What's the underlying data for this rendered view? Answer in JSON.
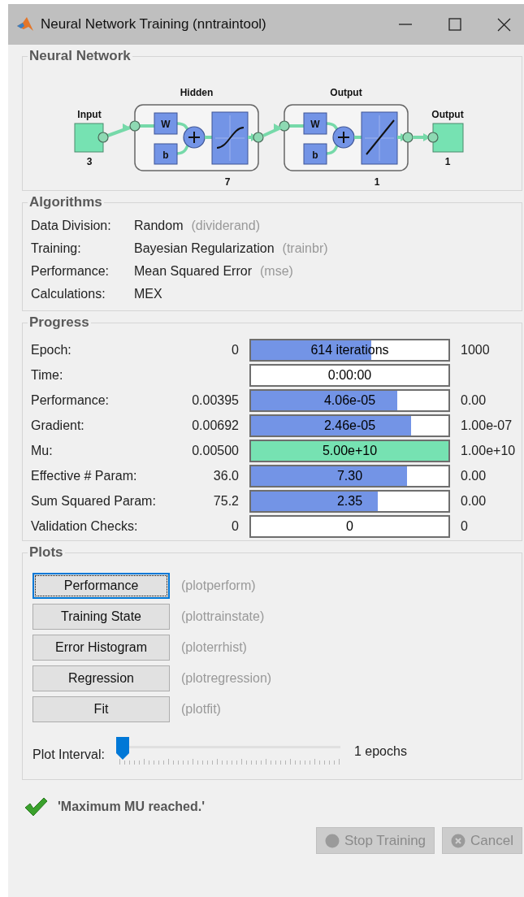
{
  "window": {
    "title": "Neural Network Training (nntraintool)"
  },
  "network": {
    "title": "Neural Network",
    "input": {
      "label": "Input",
      "size": "3"
    },
    "layers": [
      {
        "name": "Hidden",
        "size": "7",
        "kind": "sigmoid",
        "weight_label": "W",
        "bias_label": "b"
      },
      {
        "name": "Output",
        "size": "1",
        "kind": "linear",
        "weight_label": "W",
        "bias_label": "b"
      }
    ],
    "output": {
      "label": "Output",
      "size": "1"
    }
  },
  "algorithms": {
    "title": "Algorithms",
    "rows": [
      {
        "label": "Data Division:",
        "value": "Random",
        "function": "(dividerand)"
      },
      {
        "label": "Training:",
        "value": "Bayesian Regularization",
        "function": "(trainbr)"
      },
      {
        "label": "Performance:",
        "value": "Mean Squared Error",
        "function": "(mse)"
      },
      {
        "label": "Calculations:",
        "value": "MEX"
      }
    ]
  },
  "progress": {
    "title": "Progress",
    "rows": [
      {
        "label": "Epoch:",
        "start": "0",
        "reading": "614 iterations",
        "level": 0.61,
        "color": "#7394e6",
        "end": "1000"
      },
      {
        "label": "Time:",
        "reading": "0:00:00"
      },
      {
        "label": "Performance:",
        "start": "0.00395",
        "reading": "4.06e-05",
        "level": 0.74,
        "color": "#7394e6",
        "end": "0.00"
      },
      {
        "label": "Gradient:",
        "start": "0.00692",
        "reading": "2.46e-05",
        "level": 0.81,
        "color": "#7394e6",
        "end": "1.00e-07"
      },
      {
        "label": "Mu:",
        "start": "0.00500",
        "reading": "5.00e+10",
        "level": 1,
        "color": "#76e2b2",
        "end": "1.00e+10"
      },
      {
        "label": "Effective # Param:",
        "start": "36.0",
        "reading": "7.30",
        "level": 0.79,
        "color": "#7394e6",
        "end": "0.00"
      },
      {
        "label": "Sum Squared Param:",
        "start": "75.2",
        "reading": "2.35",
        "level": 0.64,
        "color": "#7394e6",
        "end": "0.00"
      },
      {
        "label": "Validation Checks:",
        "start": "0",
        "reading": "0",
        "end": "0"
      }
    ]
  },
  "plots": {
    "title": "Plots",
    "buttons": [
      {
        "label": "Performance",
        "function": "(plotperform)",
        "selected": true
      },
      {
        "label": "Training State",
        "function": "(plottrainstate)",
        "selected": false
      },
      {
        "label": "Error Histogram",
        "function": "(ploterrhist)",
        "selected": false
      },
      {
        "label": "Regression",
        "function": "(plotregression)",
        "selected": false
      },
      {
        "label": "Fit",
        "function": "(plotfit)",
        "selected": false
      }
    ],
    "interval": {
      "label": "Plot Interval:",
      "level": 0,
      "reading": "1 epochs"
    }
  },
  "status": {
    "message": "'Maximum MU reached.'"
  },
  "buttons": [
    {
      "label": "Stop Training",
      "kind": "stop",
      "disabled": true
    },
    {
      "label": "Cancel",
      "kind": "cancel",
      "disabled": true
    }
  ]
}
